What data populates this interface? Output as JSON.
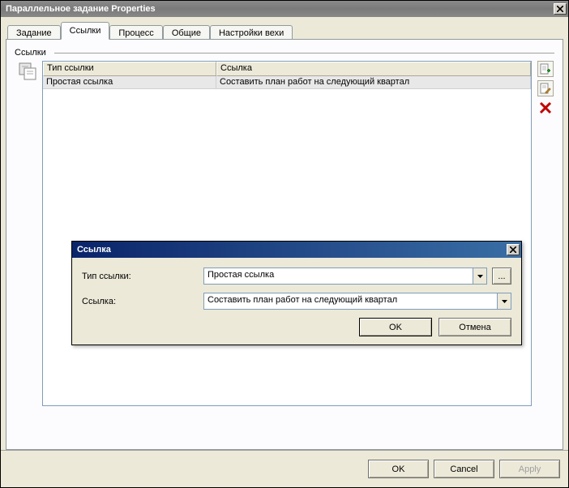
{
  "window": {
    "title": "Параллельное задание Properties"
  },
  "tabs": {
    "items": [
      {
        "label": "Задание"
      },
      {
        "label": "Ссылки"
      },
      {
        "label": "Процесс"
      },
      {
        "label": "Общие"
      },
      {
        "label": "Настройки вехи"
      }
    ],
    "active_index": 1
  },
  "section": {
    "label": "Ссылки"
  },
  "table": {
    "columns": [
      {
        "label": "Тип ссылки"
      },
      {
        "label": "Ссылка"
      }
    ],
    "rows": [
      {
        "type": "Простая ссылка",
        "link": "Составить план работ на следующий квартал"
      }
    ]
  },
  "side_icons": {
    "add": "add-link-icon",
    "edit": "edit-link-icon",
    "delete": "delete-link-icon"
  },
  "modal": {
    "title": "Ссылка",
    "type_label": "Тип ссылки:",
    "type_value": "Простая ссылка",
    "link_label": "Ссылка:",
    "link_value": "Составить план работ на следующий квартал",
    "ellipsis": "...",
    "ok": "OK",
    "cancel": "Отмена"
  },
  "footer": {
    "ok": "OK",
    "cancel": "Cancel",
    "apply": "Apply"
  }
}
